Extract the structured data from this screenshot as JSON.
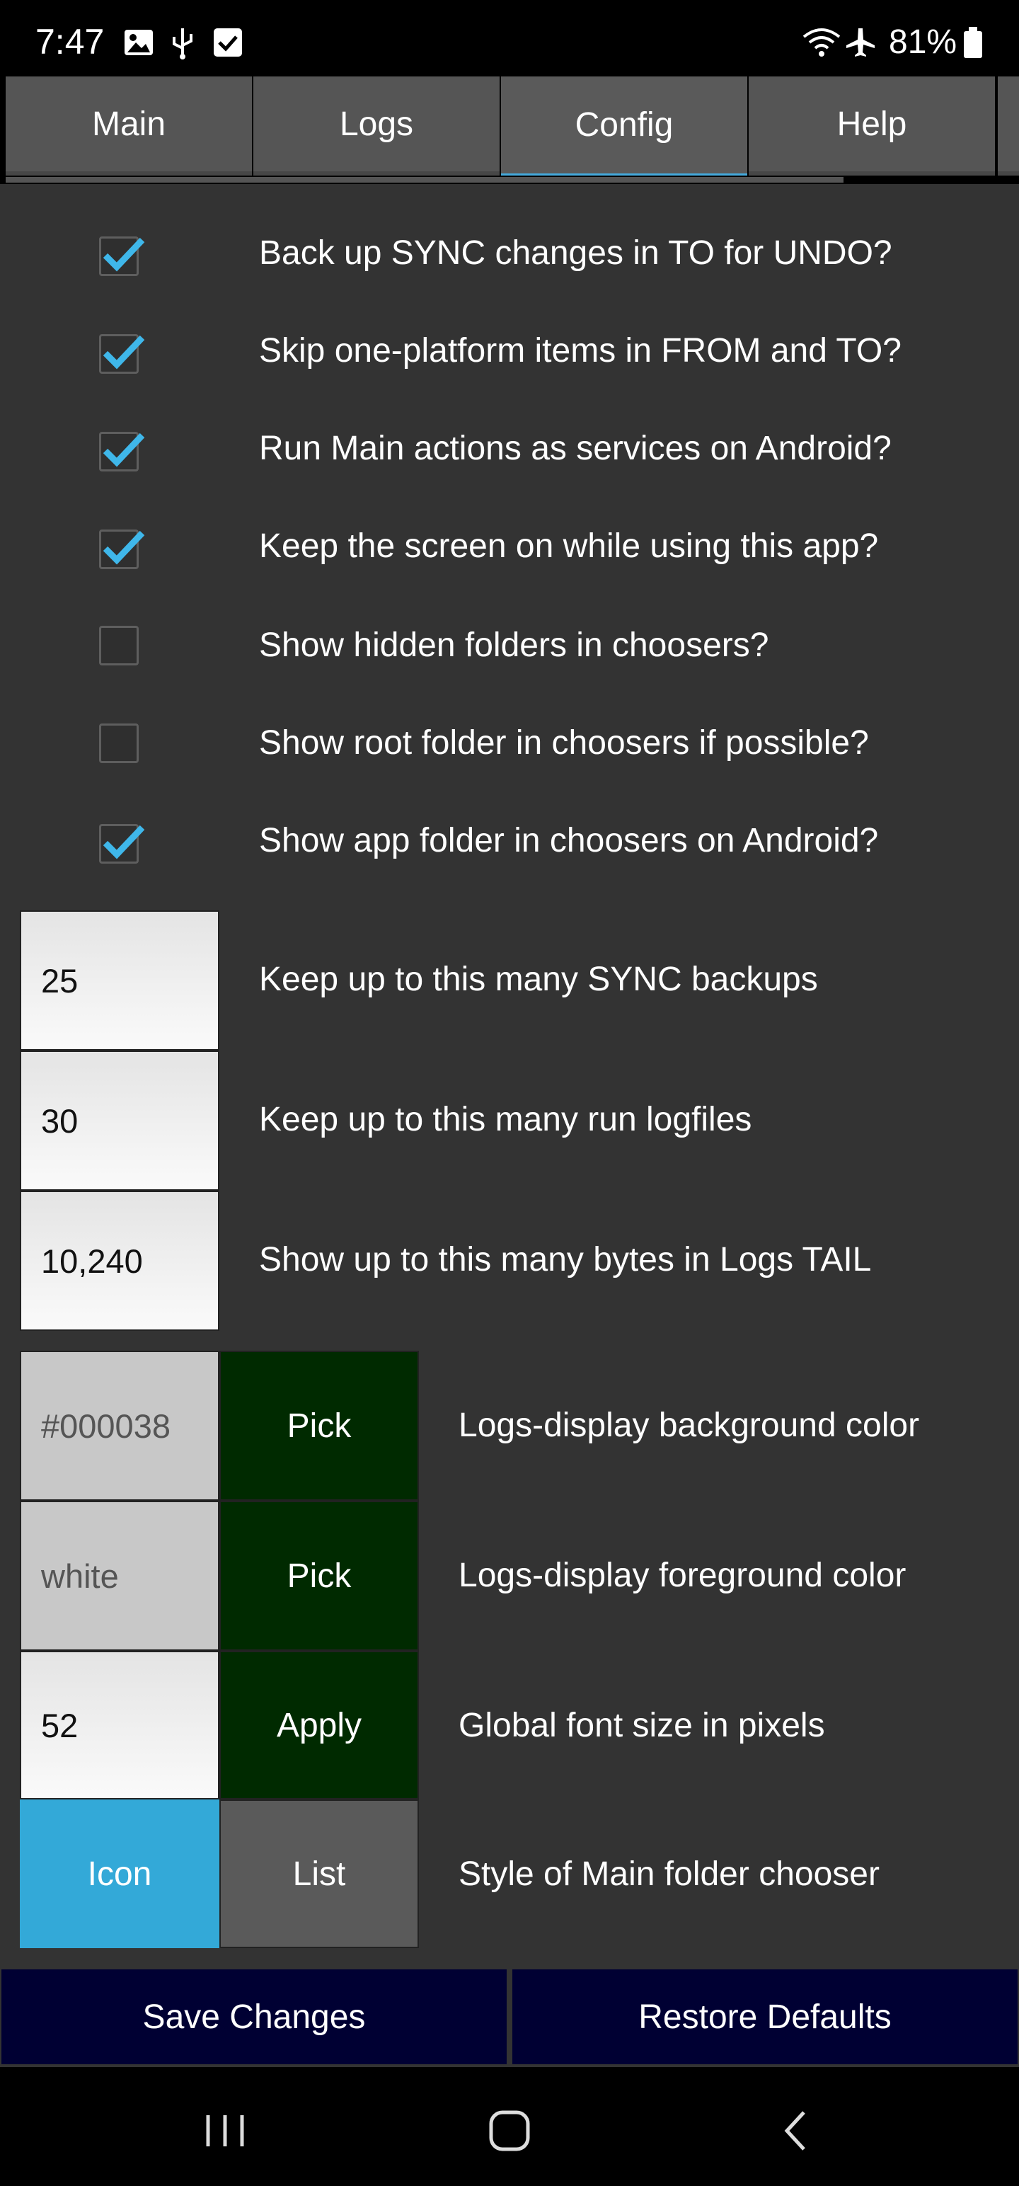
{
  "status_bar": {
    "time": "7:47",
    "battery": "81%",
    "left_icons": [
      "image-icon",
      "usb-icon",
      "checkbox-notification-icon"
    ],
    "right_icons": [
      "wifi-icon",
      "airplane-icon",
      "battery-icon"
    ]
  },
  "tabs": [
    {
      "label": "Main",
      "active": false
    },
    {
      "label": "Logs",
      "active": false
    },
    {
      "label": "Config",
      "active": true
    },
    {
      "label": "Help",
      "active": false
    }
  ],
  "checkboxes": [
    {
      "label": "Back up SYNC changes in TO for UNDO?",
      "checked": true
    },
    {
      "label": "Skip one-platform items in FROM and TO?",
      "checked": true
    },
    {
      "label": "Run Main actions as services on Android?",
      "checked": true
    },
    {
      "label": "Keep the screen on while using this app?",
      "checked": true
    },
    {
      "label": "Show hidden folders in choosers?",
      "checked": false
    },
    {
      "label": "Show root folder in choosers if possible?",
      "checked": false
    },
    {
      "label": "Show app folder in choosers on Android?",
      "checked": true
    }
  ],
  "numeric_settings": [
    {
      "value": "25",
      "label": "Keep up to this many SYNC backups"
    },
    {
      "value": "30",
      "label": "Keep up to this many run logfiles"
    },
    {
      "value": "10,240",
      "label": "Show up to this many bytes in Logs TAIL"
    }
  ],
  "color_settings": [
    {
      "value": "#000038",
      "button": "Pick",
      "label": "Logs-display background color"
    },
    {
      "value": "white",
      "button": "Pick",
      "label": "Logs-display foreground color"
    }
  ],
  "font_setting": {
    "value": "52",
    "button": "Apply",
    "label": "Global font size in pixels"
  },
  "chooser_style": {
    "option_icon": "Icon",
    "option_list": "List",
    "selected": "Icon",
    "label": "Style of Main folder chooser"
  },
  "bottom_buttons": {
    "save": "Save Changes",
    "restore": "Restore Defaults"
  },
  "colors": {
    "background": "#333333",
    "tab": "#555555",
    "accent": "#33a9d8",
    "green_button": "#002a00",
    "bottom_button": "#000033"
  },
  "nav_bar": [
    "recents-icon",
    "home-icon",
    "back-icon"
  ]
}
